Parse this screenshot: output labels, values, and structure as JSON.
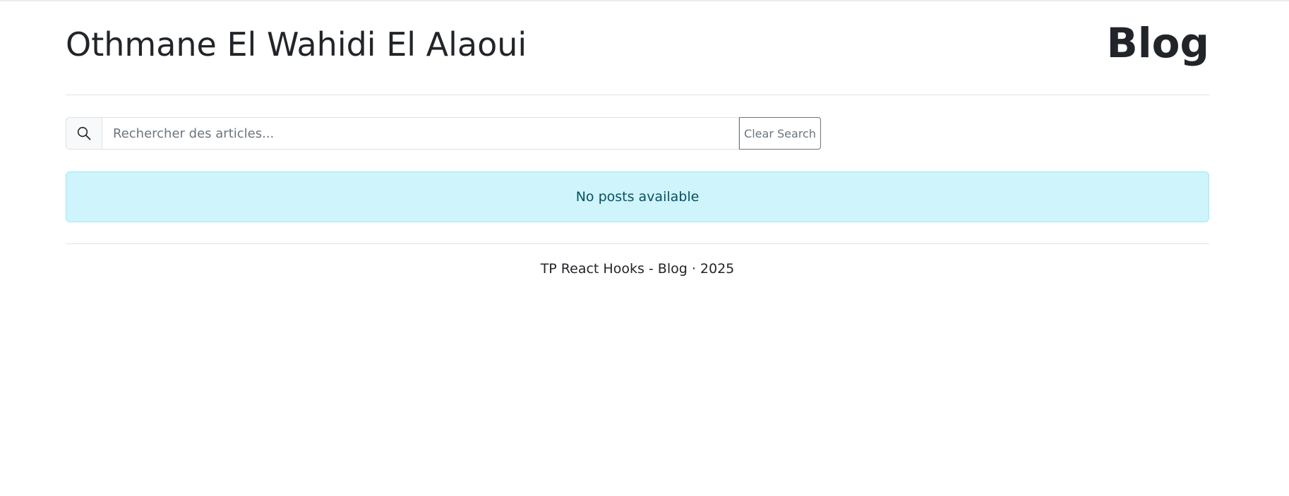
{
  "header": {
    "author_name": "Othmane El Wahidi El Alaoui",
    "section_title": "Blog"
  },
  "search": {
    "icon": "search-icon",
    "placeholder": "Rechercher des articles...",
    "value": "",
    "clear_label": "Clear Search"
  },
  "posts": {
    "empty_message": "No posts available"
  },
  "footer": {
    "text": "TP React Hooks - Blog · 2025"
  },
  "colors": {
    "text": "#212529",
    "alert_bg": "#cff4fc",
    "alert_border": "#9eeaf9",
    "alert_text": "#055160",
    "muted": "#6c757d"
  }
}
